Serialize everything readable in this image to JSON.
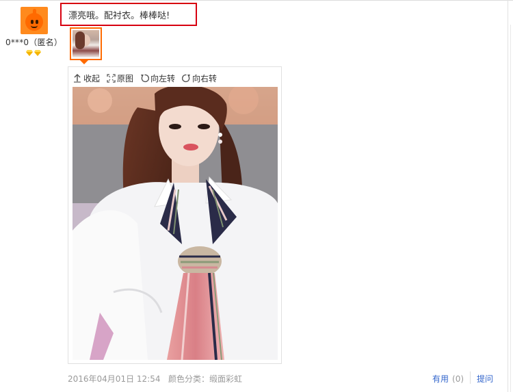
{
  "user": {
    "name": "0***0（匿名）",
    "avatar_icon": "orange-mascot-avatar",
    "badge_icons": [
      "gold-diamond-icon",
      "gold-diamond-icon"
    ]
  },
  "review": {
    "text": "漂亮哦。配衬衣。棒棒哒!",
    "highlight_color": "#d7000f"
  },
  "thumbnail": {
    "selected_border_color": "#ff6a00"
  },
  "viewer": {
    "tools": [
      {
        "icon": "collapse-arrow-icon",
        "label": "收起"
      },
      {
        "icon": "fullscreen-icon",
        "label": "原图"
      },
      {
        "icon": "rotate-left-icon",
        "label": "向左转"
      },
      {
        "icon": "rotate-right-icon",
        "label": "向右转"
      }
    ],
    "photo_description_icon": "review-photo"
  },
  "meta": {
    "date": "2016年04月01日 12:54",
    "sku": "颜色分类：缎面彩虹",
    "useful_label": "有用",
    "useful_count": "(0)",
    "ask_label": "提问"
  },
  "colors": {
    "link": "#3366cc",
    "muted": "#999999",
    "accent": "#ff6a00"
  }
}
